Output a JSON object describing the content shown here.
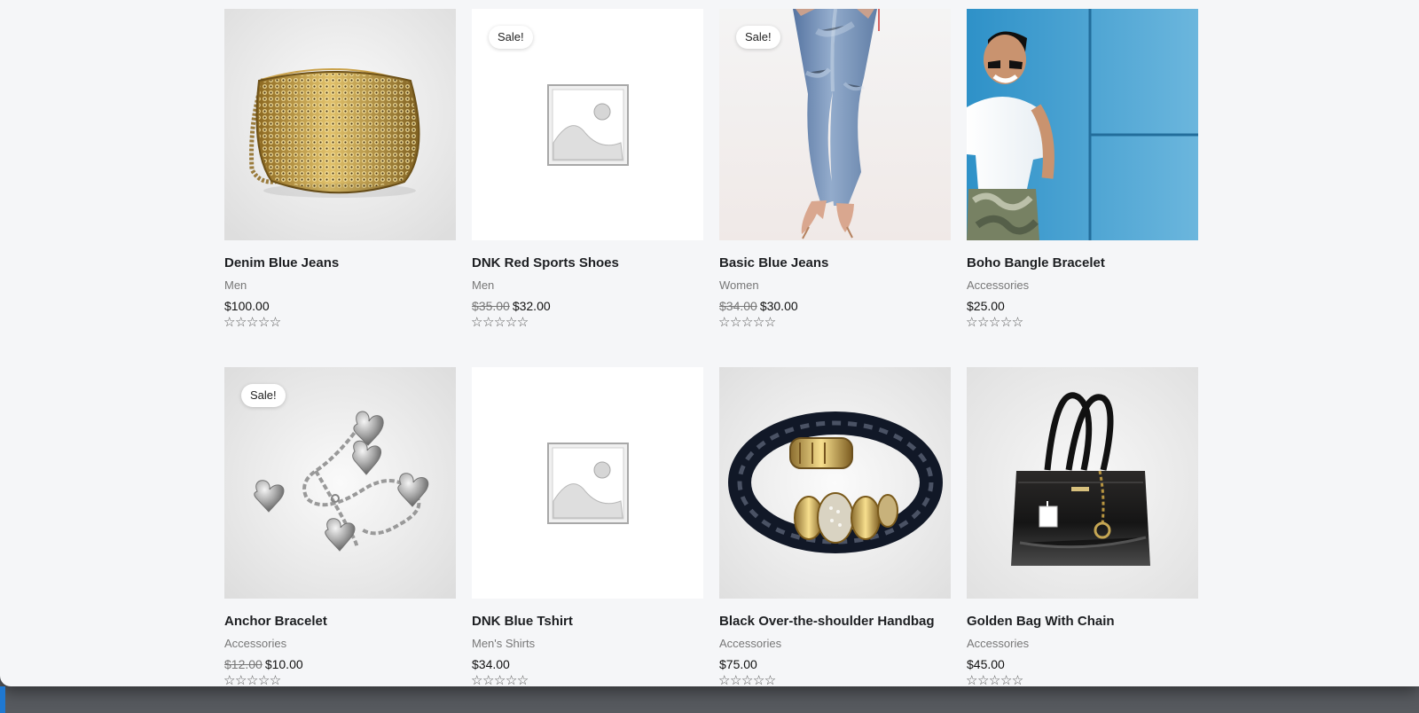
{
  "products": [
    {
      "name": "Denim Blue Jeans",
      "category": "Men",
      "old_price": "",
      "price": "$100.00",
      "sale": false,
      "image": "gold-mesh-bag-image",
      "rating": 0,
      "rating_stars": "☆☆☆☆☆"
    },
    {
      "name": "DNK Red Sports Shoes",
      "category": "Men",
      "old_price": "$35.00",
      "price": "$32.00",
      "sale": true,
      "image": "placeholder-image",
      "rating": 0,
      "rating_stars": "☆☆☆☆☆"
    },
    {
      "name": "Basic Blue Jeans",
      "category": "Women",
      "old_price": "$34.00",
      "price": "$30.00",
      "sale": true,
      "image": "blue-jeans-legs-image",
      "rating": 0,
      "rating_stars": "☆☆☆☆☆"
    },
    {
      "name": "Boho Bangle Bracelet",
      "category": "Accessories",
      "old_price": "",
      "price": "$25.00",
      "sale": false,
      "image": "smiling-man-image",
      "rating": 0,
      "rating_stars": "☆☆☆☆☆"
    },
    {
      "name": "Anchor Bracelet",
      "category": "Accessories",
      "old_price": "$12.00",
      "price": "$10.00",
      "sale": true,
      "image": "heart-charm-bracelet-image",
      "rating": 0,
      "rating_stars": "☆☆☆☆☆"
    },
    {
      "name": "DNK Blue Tshirt",
      "category": "Men's Shirts",
      "old_price": "",
      "price": "$34.00",
      "sale": false,
      "image": "placeholder-image",
      "rating": 0,
      "rating_stars": "☆☆☆☆☆"
    },
    {
      "name": "Black Over-the-shoulder Handbag",
      "category": "Accessories",
      "old_price": "",
      "price": "$75.00",
      "sale": false,
      "image": "black-braided-bracelet-image",
      "rating": 0,
      "rating_stars": "☆☆☆☆☆"
    },
    {
      "name": "Golden Bag With Chain",
      "category": "Accessories",
      "old_price": "",
      "price": "$45.00",
      "sale": false,
      "image": "black-handbag-image",
      "rating": 0,
      "rating_stars": "☆☆☆☆☆"
    }
  ],
  "sale_label": "Sale!",
  "colors": {
    "page_background": "#f5f6f8",
    "text_primary": "#1d1f22",
    "text_secondary": "#777777",
    "badge_background": "#ffffff",
    "desktop_background": "#595c61",
    "accent_blue": "#1f78d1"
  }
}
